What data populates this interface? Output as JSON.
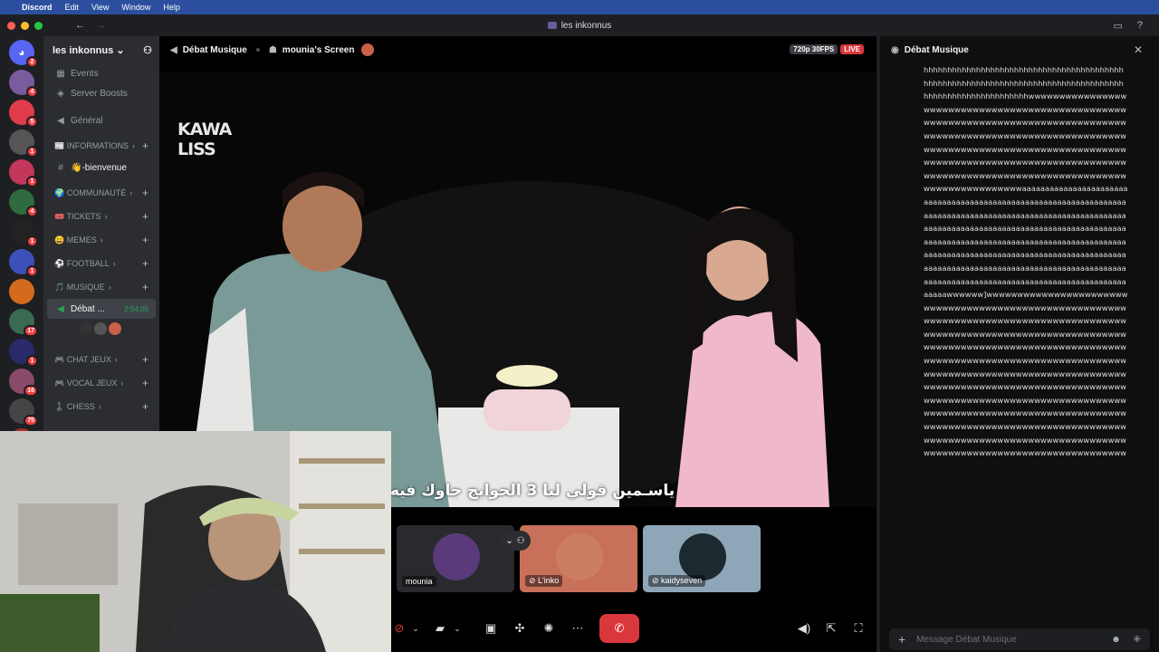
{
  "menubar": {
    "app": "Discord",
    "items": [
      "Edit",
      "View",
      "Window",
      "Help"
    ]
  },
  "window": {
    "title": "les inkonnus"
  },
  "guilds": [
    {
      "icon": "discord-logo",
      "badge": "2",
      "color": "#5865f2"
    },
    {
      "icon": "server-avatar",
      "badge": "4",
      "color": "#7a5c9e"
    },
    {
      "icon": "server-avatar",
      "badge": "5",
      "color": "#e03c4c"
    },
    {
      "icon": "server-avatar",
      "badge": "1",
      "color": "#555"
    },
    {
      "icon": "server-avatar",
      "badge": "1",
      "color": "#c2375a"
    },
    {
      "icon": "server-avatar",
      "badge": "4",
      "color": "#2f6b3e"
    },
    {
      "icon": "server-avatar",
      "badge": "1",
      "color": "#222"
    },
    {
      "icon": "server-avatar",
      "badge": "1",
      "color": "#3d4fb8"
    },
    {
      "icon": "server-avatar",
      "badge": "",
      "color": "#d46b1c"
    },
    {
      "icon": "server-avatar",
      "badge": "17",
      "color": "#3a6b52"
    },
    {
      "icon": "server-avatar",
      "badge": "1",
      "color": "#2a2a6a"
    },
    {
      "icon": "server-avatar",
      "badge": "16",
      "color": "#8a4a6a"
    },
    {
      "icon": "server-avatar",
      "badge": "75",
      "color": "#444"
    },
    {
      "icon": "server-avatar",
      "badge": "",
      "color": "#a03030"
    }
  ],
  "sidebar": {
    "server_name": "les inkonnus",
    "events": "Events",
    "boosts": "Server Boosts",
    "general": "Général",
    "categories": [
      {
        "label": "📰 INFORMATIONS"
      },
      {
        "label": "🌍 COMMUNAUTÉ"
      },
      {
        "label": "🎟️ TICKETS"
      },
      {
        "label": "😄 MEMES"
      },
      {
        "label": "⚽ FOOTBALL"
      },
      {
        "label": "🎵 MUSIQUE"
      },
      {
        "label": "🎮 CHAT JEUX"
      },
      {
        "label": "🎮 VOCAL JEUX"
      },
      {
        "label": "♟️ CHESS"
      }
    ],
    "bienvenue": "👋-bienvenue",
    "active_channel": "Débat ...",
    "active_timer": "2:54:05"
  },
  "stream": {
    "channel": "Débat Musique",
    "screen": "mounia's Screen",
    "quality": "720p 30FPS",
    "live": "LIVE",
    "brand_line1": "KAWA",
    "brand_line2": "LISS",
    "subtitle": "ياسـمين قولي ليا 3 الحوايج جاوك فيه"
  },
  "participants": [
    {
      "name": "mounia",
      "bg": "#2a2a2e",
      "avatar": "#5a3a7a"
    },
    {
      "name": "L'inko",
      "bg": "#c8705a",
      "avatar": "#d08c6c"
    },
    {
      "name": "kaidyseven",
      "bg": "#8ea7b8",
      "avatar": "#1c2a30"
    }
  ],
  "chat": {
    "title": "Débat Musique",
    "placeholder": "Message Débat Musique",
    "message": "hhhhhhhhhhhhhhhhhhhhhhhhhhhhhhhhhhhhhhhhhhhhhhhhhhhhhhhhhhhhhhhhhhhhhhhhhhhhhhhhhhhhhhhhhhhhhhhhhhhhhhhhhhwwwwwwwwwwwwwwwwwwwwwwwwwwwwwwwwwwwwwwwwwwwwwwwwwwwwwwwwwwwwwwwwwwwwwwwwwwwwwwwwwwwwwwwwwwwwwwwwwwwwwwwwwwwwwwwwwwwwwwwwwwwwwwwwwwwwwwwwwwwwwwwwwwwwwwwwwwwwwwwwwwwwwwwwwwwwwwwwwwwwwwwwwwwwwwwwwwwwwwwwwwwwwwwwwwwwwwwwwwwwwwwwwwwwwwaaaaaaaaaaaaaaaaaaaaaaaaaaaaaaaaaaaaaaaaaaaaaaaaaaaaaaaaaaaaaaaaaaaaaaaaaaaaaaaaaaaaaaaaaaaaaaaaaaaaaaaaaaaaaaaaaaaaaaaaaaaaaaaaaaaaaaaaaaaaaaaaaaaaaaaaaaaaaaaaaaaaaaaaaaaaaaaaaaaaaaaaaaaaaaaaaaaaaaaaaaaaaaaaaaaaaaaaaaaaaaaaaaaaaaaaaaaaaaaaaaaaaaaaaaaaaaaaaaaaaaaaaaaaaaaaaaaaaaaaaaaaaaaaaaaaaaaaaaaaaaaaaaaaaaaaaaaaaaaaaaaaaaaaaaaaaaaawwwwww]wwwwwwwwwwwwwwwwwwwwwwwwwwwwwwwwwwwwwwwwwwwwwwwwwwwwwwwwwwwwwwwwwwwwwwwwwwwwwwwwwwwwwwwwwwwwwwwwwwwwwwwwwwwwwwwwwwwwwwwwwwwwwwwwwwwwwwwwwwwwwwwwwwwwwwwwwwwwwwwwwwwwwwwwwwwwwwwwwwwwwwwwwwwwwwwwwwwwwwwwwwwwwwwwwwwwwwwwwwwwwwwwwwwwwwwwwwwwwwwwwwwwwwwwwwwwwwwwwwwwwwwwwwwwwwwwwwwwwwwwwwwwwwwwwwwwwwwwwwwwwwwwwwwwwwwwwwwwwwwwwwwwwwwwwwwwwwwwwwwwwwwwwwwwwwwwwwwwwwwwwwwwwwwwwwwwwwwwwwwwwwwwwwwwwwwwwwwwwwwwwwwwwwwwwwwwwwwwwww"
  }
}
